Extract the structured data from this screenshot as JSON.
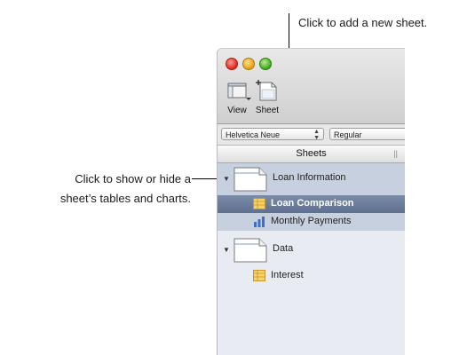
{
  "callouts": {
    "top": "Click to add a new sheet.",
    "left_line1": "Click to show or hide a",
    "left_line2": "sheet’s tables and charts."
  },
  "toolbar": {
    "view_label": "View",
    "sheet_label": "Sheet"
  },
  "format_bar": {
    "font_value": "Helvetica Neue",
    "style_value": "Regular"
  },
  "sidebar": {
    "header": "Sheets",
    "sheets": [
      {
        "label": "Loan Information",
        "expanded": true,
        "items": [
          {
            "label": "Loan Comparison",
            "icon": "table-icon",
            "selected": true
          },
          {
            "label": "Monthly Payments",
            "icon": "chart-icon",
            "selected": false
          }
        ]
      },
      {
        "label": "Data",
        "expanded": true,
        "items": [
          {
            "label": "Interest",
            "icon": "table-icon",
            "selected": false
          }
        ]
      }
    ]
  },
  "colors": {
    "selection": "#6b7c9c",
    "sheet_block": "#c7d0de",
    "sidebar_bg": "#e8ecf2"
  }
}
